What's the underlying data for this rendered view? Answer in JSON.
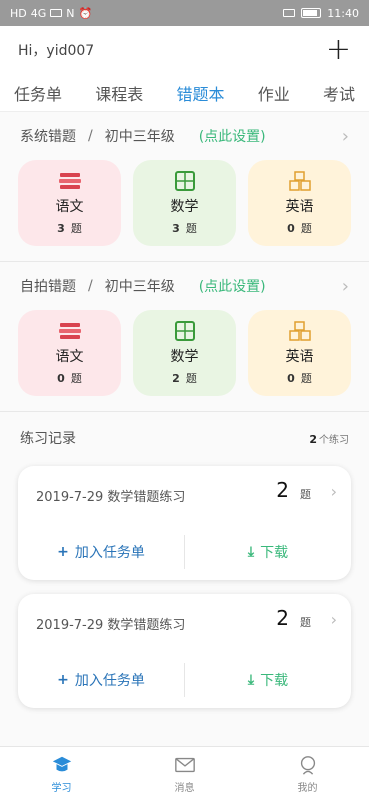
{
  "status": {
    "time": "11:40",
    "net": "HD",
    "signal": "4G",
    "nfc": "N"
  },
  "header": {
    "greeting": "Hi，yid007",
    "add": "+"
  },
  "tabs": [
    {
      "label": "任务单"
    },
    {
      "label": "课程表"
    },
    {
      "label": "错题本",
      "active": true
    },
    {
      "label": "作业"
    },
    {
      "label": "考试"
    }
  ],
  "system": {
    "title": "系统错题",
    "sep": "/",
    "grade": "初中三年级",
    "link": "(点此设置)",
    "subjects": [
      {
        "name": "语文",
        "count": "3",
        "unit": "题"
      },
      {
        "name": "数学",
        "count": "3",
        "unit": "题"
      },
      {
        "name": "英语",
        "count": "0",
        "unit": "题"
      }
    ]
  },
  "selfie": {
    "title": "自拍错题",
    "sep": "/",
    "grade": "初中三年级",
    "link": "(点此设置)",
    "subjects": [
      {
        "name": "语文",
        "count": "0",
        "unit": "题"
      },
      {
        "name": "数学",
        "count": "2",
        "unit": "题"
      },
      {
        "name": "英语",
        "count": "0",
        "unit": "题"
      }
    ]
  },
  "practice": {
    "title": "练习记录",
    "count": "2",
    "count_unit": "个练习",
    "records": [
      {
        "title": "2019-7-29 数学错题练习",
        "num": "2",
        "unit": "题",
        "add": "加入任务单",
        "download": "下载"
      },
      {
        "title": "2019-7-29 数学错题练习",
        "num": "2",
        "unit": "题",
        "add": "加入任务单",
        "download": "下载"
      }
    ]
  },
  "nav": [
    {
      "label": "学习",
      "icon": "study-icon",
      "active": true
    },
    {
      "label": "消息",
      "icon": "message-icon"
    },
    {
      "label": "我的",
      "icon": "profile-icon"
    }
  ],
  "colors": {
    "accent": "#2a8cd8",
    "link": "#3ab87b",
    "add": "#2a74b8"
  }
}
